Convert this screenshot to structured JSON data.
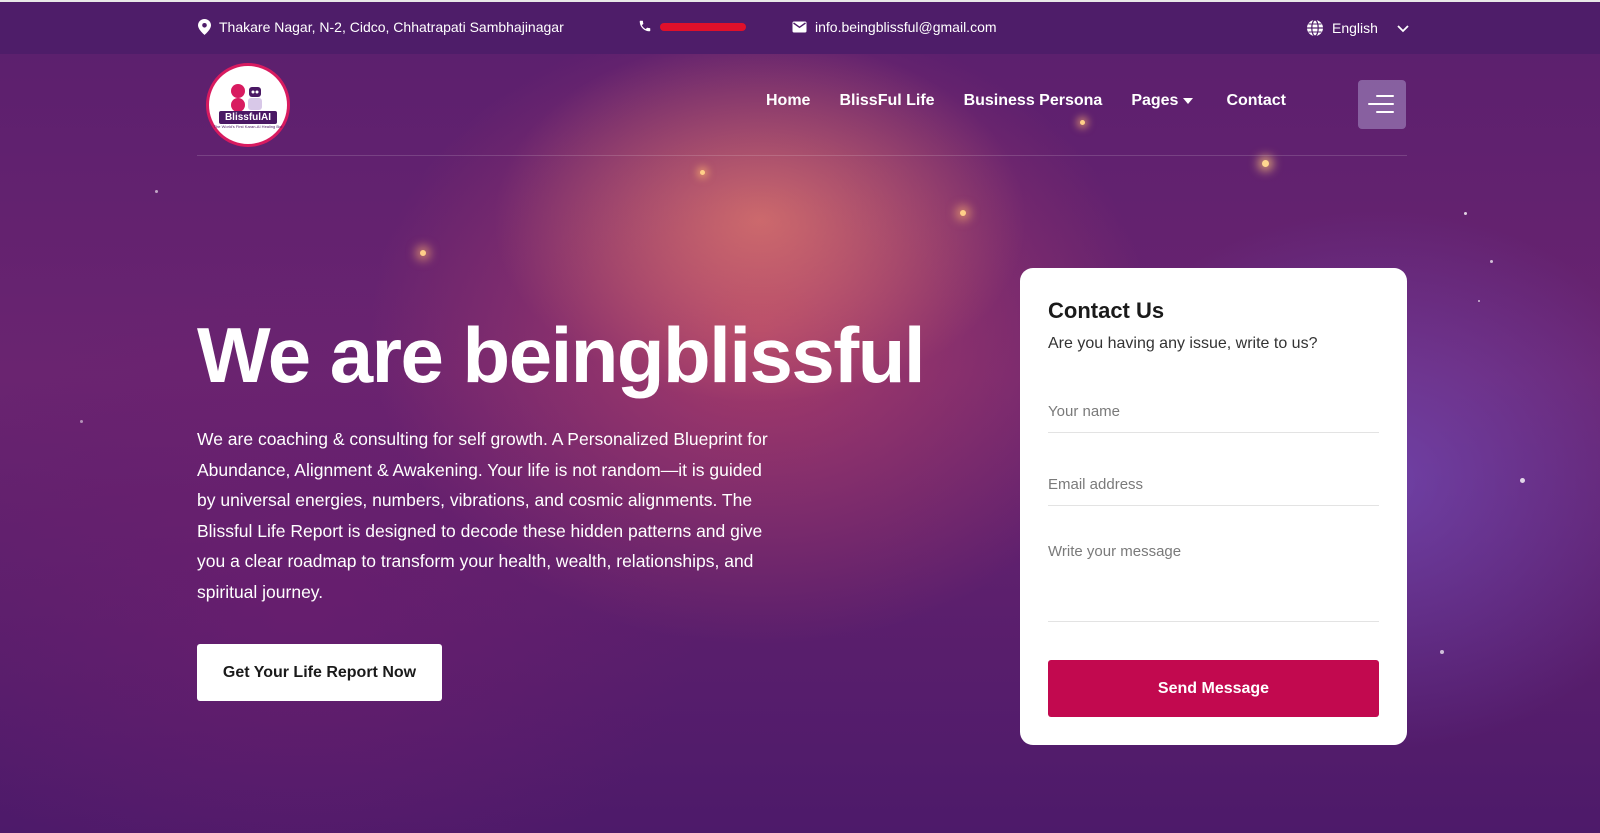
{
  "topbar": {
    "address": "Thakare Nagar, N-2, Cidco, Chhatrapati Sambhajinagar",
    "email": "info.beingblissful@gmail.com",
    "language": "English"
  },
  "logo": {
    "wordmark": "BlissfulAI",
    "tagline": "The World's First Karan-AI Healing Bot"
  },
  "nav": {
    "items": [
      {
        "label": "Home"
      },
      {
        "label": "BlissFul Life"
      },
      {
        "label": "Business Persona"
      },
      {
        "label": "Pages"
      },
      {
        "label": "Contact"
      }
    ]
  },
  "hero": {
    "title": "We are beingblissful",
    "description": "We are coaching & consulting for self growth. A Personalized Blueprint for Abundance, Alignment & Awakening. Your life is not random—it is guided by universal energies, numbers, vibrations, and cosmic alignments. The Blissful Life Report is designed to decode these hidden patterns and give you a clear roadmap to transform your health, wealth, relationships, and spiritual journey.",
    "cta": "Get Your Life Report Now"
  },
  "contact": {
    "title": "Contact Us",
    "subtitle": "Are you having any issue, write to us?",
    "name_placeholder": "Your name",
    "email_placeholder": "Email address",
    "message_placeholder": "Write your message",
    "submit": "Send Message"
  },
  "colors": {
    "topbar_bg": "#4e1d69",
    "accent": "#c2094f",
    "hero_bg": "#5a1f6e"
  }
}
